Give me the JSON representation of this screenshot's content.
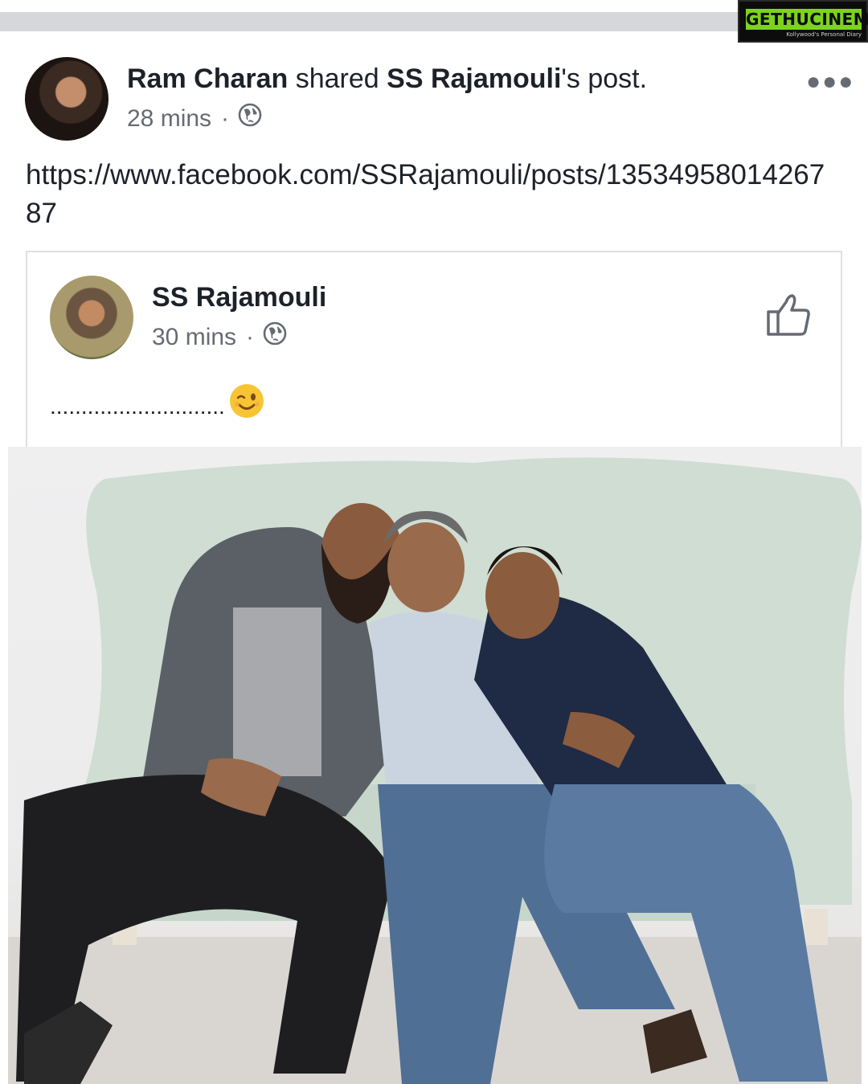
{
  "watermark": {
    "brand": "GETHUCINEMA",
    "tagline": "Kollywood's Personal Diary"
  },
  "post": {
    "author": "Ram Charan",
    "action": " shared ",
    "shared_author": "SS Rajamouli",
    "suffix": "'s post.",
    "time": "28 mins",
    "separator": "·",
    "privacy_icon": "globe-icon",
    "more_icon": "more-dots-icon",
    "text": "https://www.facebook.com/SSRajamouli/posts/1353495801426787"
  },
  "shared_post": {
    "author": "SS Rajamouli",
    "time": "30 mins",
    "separator": "·",
    "privacy_icon": "globe-icon",
    "action_icon": "like-thumb-icon",
    "text": "............................",
    "emoji": "winking-face-icon"
  },
  "colors": {
    "text_primary": "#1d2129",
    "text_secondary": "#666b73",
    "border": "#dddfe2",
    "top_bar": "#d6d7da",
    "watermark_green": "#7bd31f"
  }
}
